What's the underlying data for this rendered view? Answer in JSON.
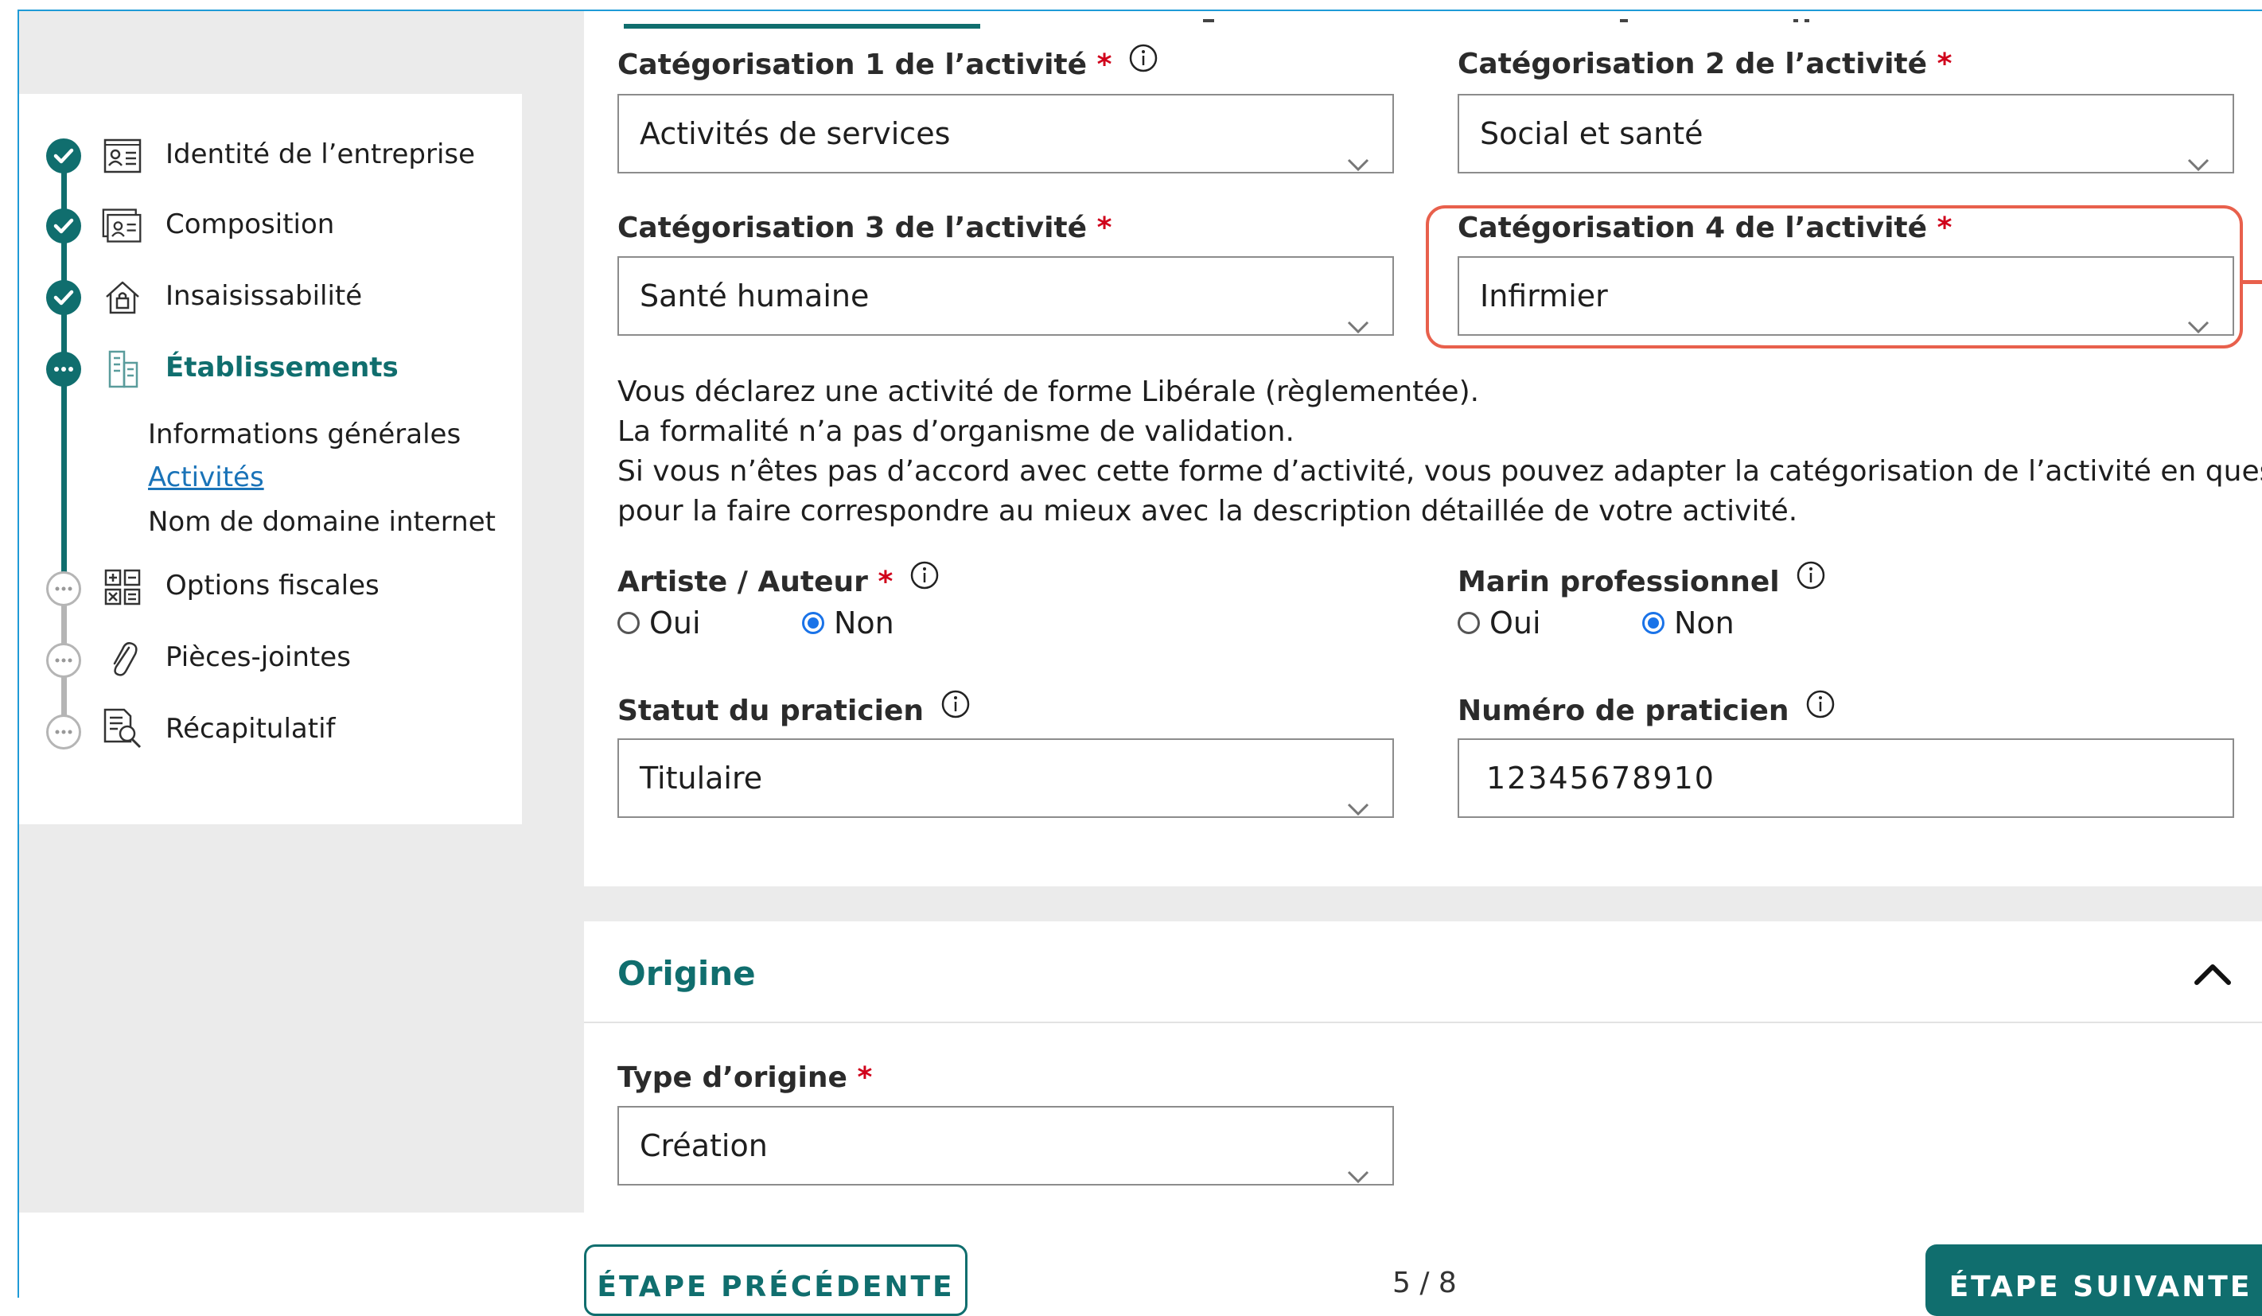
{
  "sidebar": {
    "steps": [
      {
        "label": "Identité de l’entreprise",
        "status": "done",
        "icon": "id-card-icon"
      },
      {
        "label": "Composition",
        "status": "done",
        "icon": "people-card-icon"
      },
      {
        "label": "Insaisissabilité",
        "status": "done",
        "icon": "house-lock-icon"
      },
      {
        "label": "Établissements",
        "status": "current",
        "icon": "building-icon"
      },
      {
        "label": "Options fiscales",
        "status": "todo",
        "icon": "calculator-icon"
      },
      {
        "label": "Pièces-jointes",
        "status": "todo",
        "icon": "paperclip-icon"
      },
      {
        "label": "Récapitulatif",
        "status": "todo",
        "icon": "document-search-icon"
      }
    ],
    "substeps": [
      {
        "label": "Informations générales"
      },
      {
        "label": "Activités",
        "active": true
      },
      {
        "label": "Nom de domaine internet"
      }
    ]
  },
  "form": {
    "cat1": {
      "label": "Catégorisation 1 de l’activité",
      "required": "*",
      "value": "Activités de services"
    },
    "cat2": {
      "label": "Catégorisation 2 de l’activité",
      "required": "*",
      "value": "Social et santé"
    },
    "cat3": {
      "label": "Catégorisation 3 de l’activité",
      "required": "*",
      "value": "Santé humaine"
    },
    "cat4": {
      "label": "Catégorisation 4 de l’activité",
      "required": "*",
      "value": "Infirmier"
    },
    "notice": {
      "line1": "Vous déclarez une activité de forme Libérale (règlementée).",
      "line2": "La formalité n’a pas d’organisme de validation.",
      "line3": "Si vous n’êtes pas d’accord avec cette forme d’activité, vous pouvez adapter la catégorisation de l’activité en question",
      "line4": "pour la faire correspondre au mieux avec la description détaillée de votre activité."
    },
    "artiste": {
      "label": "Artiste / Auteur",
      "required": "*",
      "oui": "Oui",
      "non": "Non",
      "selected": "Non"
    },
    "marin": {
      "label": "Marin professionnel",
      "oui": "Oui",
      "non": "Non",
      "selected": "Non"
    },
    "statut": {
      "label": "Statut du praticien",
      "value": "Titulaire"
    },
    "numero": {
      "label": "Numéro de praticien",
      "value": "12345678910"
    }
  },
  "origin": {
    "title": "Origine",
    "type_label": "Type d’origine",
    "required": "*",
    "type_value": "Création"
  },
  "footer": {
    "prev": "ÉTAPE PRÉCÉDENTE",
    "pager": "5 / 8",
    "next": "ÉTAPE SUIVANTE"
  },
  "colors": {
    "brand": "#106e6e",
    "required": "#d0021b",
    "highlight": "#e8604c",
    "link": "#1a73b8",
    "radio": "#1a73e8"
  }
}
